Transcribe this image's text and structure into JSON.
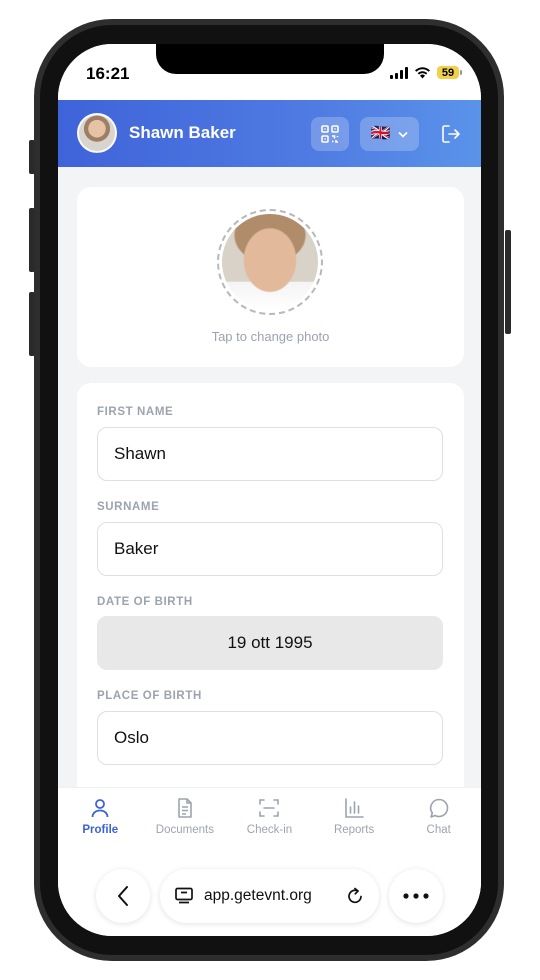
{
  "status_bar": {
    "time": "16:21",
    "battery": "59"
  },
  "header": {
    "user_name": "Shawn Baker",
    "language_flag": "🇬🇧"
  },
  "photo": {
    "hint": "Tap to change photo"
  },
  "form": {
    "first_name_label": "FIRST NAME",
    "first_name_value": "Shawn",
    "surname_label": "SURNAME",
    "surname_value": "Baker",
    "dob_label": "DATE OF BIRTH",
    "dob_value": "19 ott 1995",
    "pob_label": "PLACE OF BIRTH",
    "pob_value": "Oslo"
  },
  "nav": {
    "items": [
      {
        "label": "Profile",
        "icon": "person-icon",
        "active": true
      },
      {
        "label": "Documents",
        "icon": "document-icon",
        "active": false
      },
      {
        "label": "Check-in",
        "icon": "scan-icon",
        "active": false
      },
      {
        "label": "Reports",
        "icon": "bar-chart-icon",
        "active": false
      },
      {
        "label": "Chat",
        "icon": "chat-bubble-icon",
        "active": false
      }
    ]
  },
  "browser": {
    "url": "app.getevnt.org"
  },
  "colors": {
    "accent": "#3b63d8",
    "header_gradient_start": "#3f63d9",
    "header_gradient_end": "#5a93ea"
  }
}
